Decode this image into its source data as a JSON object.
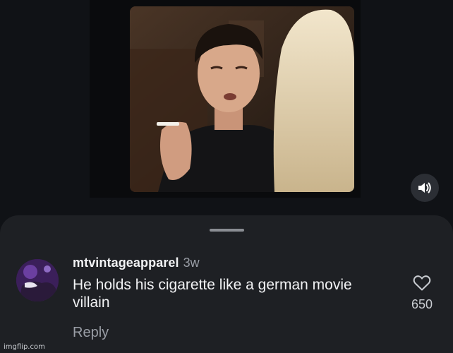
{
  "video": {
    "description_icon": "video-still",
    "mute_icon": "volume-icon"
  },
  "comment": {
    "username": "mtvintageapparel",
    "timestamp": "3w",
    "text": "He holds his cigarette like a german movie villain",
    "reply_label": "Reply",
    "like_icon": "heart-outline-icon",
    "like_count": "650"
  },
  "watermark": "imgflip.com",
  "colors": {
    "background": "#101216",
    "sheet": "#1e2024",
    "primary_text": "#f1f2f4",
    "secondary_text": "#9a9ea6"
  }
}
